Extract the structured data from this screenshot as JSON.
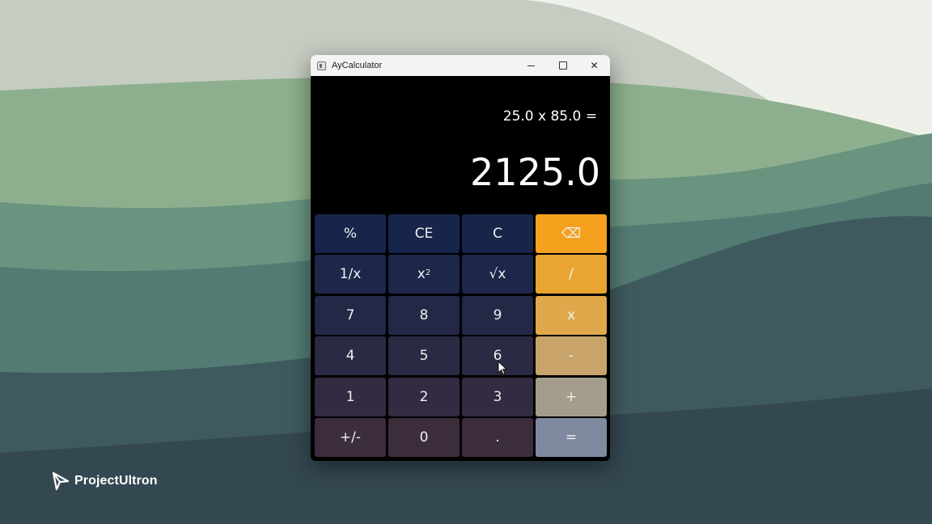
{
  "window": {
    "title": "AyCalculator",
    "controls": {
      "minimize": "minimize",
      "maximize": "maximize",
      "close": "✕"
    }
  },
  "display": {
    "expression": "25.0 x 85.0 =",
    "result": "2125.0"
  },
  "keys": [
    {
      "label": "%",
      "name": "percent-key",
      "color": "#17254a"
    },
    {
      "label": "CE",
      "name": "clear-entry-key",
      "color": "#17254a"
    },
    {
      "label": "C",
      "name": "clear-key",
      "color": "#17254a"
    },
    {
      "label": "⌫",
      "name": "backspace-key",
      "color": "#f5a11d"
    },
    {
      "label": "1/x",
      "name": "reciprocal-key",
      "color": "#1c2749"
    },
    {
      "label": "x²",
      "name": "square-key",
      "color": "#1c2749"
    },
    {
      "label": "√x",
      "name": "square-root-key",
      "color": "#1c2749"
    },
    {
      "label": "/",
      "name": "divide-key",
      "color": "#e9a532"
    },
    {
      "label": "7",
      "name": "digit-7-key",
      "color": "#232846"
    },
    {
      "label": "8",
      "name": "digit-8-key",
      "color": "#232846"
    },
    {
      "label": "9",
      "name": "digit-9-key",
      "color": "#232846"
    },
    {
      "label": "x",
      "name": "multiply-key",
      "color": "#dfa84a"
    },
    {
      "label": "4",
      "name": "digit-4-key",
      "color": "#2b2a44"
    },
    {
      "label": "5",
      "name": "digit-5-key",
      "color": "#2b2a44"
    },
    {
      "label": "6",
      "name": "digit-6-key",
      "color": "#2b2a44"
    },
    {
      "label": "-",
      "name": "subtract-key",
      "color": "#c9a46a"
    },
    {
      "label": "1",
      "name": "digit-1-key",
      "color": "#332b41"
    },
    {
      "label": "2",
      "name": "digit-2-key",
      "color": "#332b41"
    },
    {
      "label": "3",
      "name": "digit-3-key",
      "color": "#332b41"
    },
    {
      "label": "+",
      "name": "add-key",
      "color": "#a59d8c"
    },
    {
      "label": "+/-",
      "name": "negate-key",
      "color": "#3c2d3d"
    },
    {
      "label": "0",
      "name": "digit-0-key",
      "color": "#3c2d3d"
    },
    {
      "label": ".",
      "name": "decimal-key",
      "color": "#3c2d3d"
    },
    {
      "label": "=",
      "name": "equals-key",
      "color": "#7f8aa0"
    }
  ],
  "brand": {
    "name": "ProjectUltron",
    "icon": "paper-plane-icon"
  },
  "background_colors": [
    "#c4cbc0",
    "#86a888",
    "#62887a",
    "#4b6e6a",
    "#3a5058",
    "#30434d"
  ]
}
